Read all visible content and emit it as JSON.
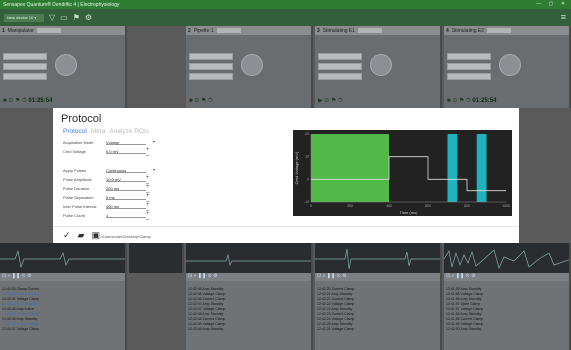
{
  "app": {
    "title": "Sensapex Quantum® Dendritic 4 | Electrophysiology",
    "toolbar_select": "New device 10 ▾"
  },
  "panels": [
    {
      "num": "1",
      "label": "Manipulator",
      "time": "01:25:54"
    },
    {
      "num": "2",
      "label": "Pipette 1",
      "time": ""
    },
    {
      "num": "3",
      "label": "Stimulating E1",
      "time": ""
    },
    {
      "num": "4",
      "label": "Stimulating E2",
      "time": "01:25:54"
    }
  ],
  "modal": {
    "title": "Protocol",
    "tabs": [
      "Protocol",
      "Meta",
      "Analyze ROIs"
    ],
    "fields": [
      {
        "label": "Acquisition Mode",
        "value": "Vclamp",
        "control": "dropdown"
      },
      {
        "label": "Cmd Voltage",
        "value": "0.0 mV",
        "control": "stepper"
      },
      {
        "label": "Apply Pulses",
        "value": "Continuous",
        "control": "dropdown"
      },
      {
        "label": "Pulse Amplitude",
        "value": "10.0 mV",
        "control": "stepper"
      },
      {
        "label": "Pulse Duration",
        "value": "200 ms",
        "control": "stepper"
      },
      {
        "label": "Pulse Separation",
        "value": "5 ms",
        "control": "stepper"
      },
      {
        "label": "Inter Pulse Interval",
        "value": "400 ms",
        "control": "stepper"
      },
      {
        "label": "Pulse Count",
        "value": "1",
        "control": "stepper"
      }
    ],
    "save_path": "C:\\Users\\user\\Desktop\\Clamp"
  },
  "chart_data": {
    "type": "line",
    "ylabel": "Cmd Voltage (mV)",
    "xlabel": "Time (ms)",
    "xlim": [
      0,
      1000
    ],
    "ylim": [
      -10,
      20
    ],
    "x_ticks": [
      0,
      200,
      400,
      600,
      800,
      1000
    ],
    "y_ticks": [
      -10,
      0,
      10,
      20
    ],
    "shaded_regions": [
      {
        "start": 0,
        "end": 400,
        "color": "#52b848"
      },
      {
        "start": 700,
        "end": 750,
        "color": "#1fb3bd"
      },
      {
        "start": 850,
        "end": 900,
        "color": "#1fb3bd"
      }
    ],
    "series": [
      {
        "color": "#dddddd",
        "x": [
          0,
          400,
          400,
          600,
          600,
          650,
          650,
          800,
          800,
          1000
        ],
        "y": [
          0,
          0,
          10,
          10,
          0,
          0,
          0,
          0,
          -5,
          -5
        ]
      }
    ]
  },
  "logs": [
    [
      "12:43:33 Clamp Current",
      "12:43:33 Clamp Voltage",
      "12:43:34 Voltage Clamp",
      "12:43:34 Amp Standby",
      "12:43:35 Amp Active",
      "12:43:36 Voltage Clamp",
      "12:43:36 Amp Standby",
      "12:43:37 Clamp Voltage",
      "12:43:37 Voltage Clamp"
    ],
    [
      "12:42:45 Amp Standby",
      "12:42:46 Voltage Clamp",
      "12:42:46 Current Clamp",
      "12:42:47 Amp Standby",
      "12:42:47 Voltage Clamp",
      "12:42:48 Amp Standby",
      "12:42:48 Current Clamp",
      "12:42:49 Voltage Clamp",
      "12:42:49 Amp Standby"
    ],
    [
      "12:42:20 Current Clamp",
      "12:42:21 Amp Standby",
      "12:42:21 Current Clamp",
      "12:42:22 Voltage Clamp",
      "12:42:23 Amp Standby",
      "12:42:23 Current Clamp",
      "12:42:24 Voltage Clamp",
      "12:42:25 Amp Standby",
      "12:42:26 Voltage Clamp"
    ],
    [
      "12:41:55 Amp Standby",
      "12:41:56 Voltage Clamp",
      "12:41:56 Amp Standby",
      "12:41:57 Open Clamp",
      "12:41:57 Voltage Clamp",
      "12:41:58 Amp Standby",
      "12:41:58 Current Clamp",
      "12:41:59 Voltage Clamp",
      "12:42:00 Amp Standby"
    ]
  ]
}
